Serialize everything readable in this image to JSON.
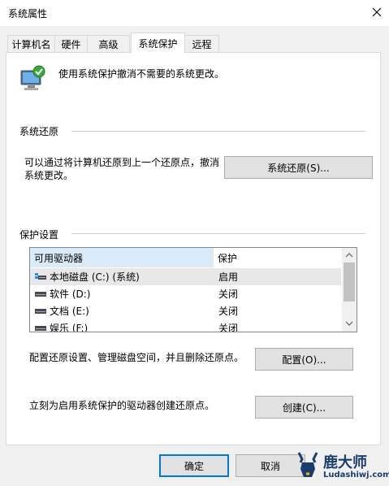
{
  "window": {
    "title": "系统属性"
  },
  "tabs": [
    {
      "label": "计算机名"
    },
    {
      "label": "硬件"
    },
    {
      "label": "高级"
    },
    {
      "label": "系统保护"
    },
    {
      "label": "远程"
    }
  ],
  "intro": {
    "text": "使用系统保护撤消不需要的系统更改。"
  },
  "restore": {
    "heading": "系统还原",
    "description_line1": "可以通过将计算机还原到上一个还原点，撤消",
    "description_line2": "系统更改。",
    "button": "系统还原(S)..."
  },
  "protection": {
    "heading": "保护设置",
    "columns": [
      "可用驱动器",
      "保护"
    ],
    "rows": [
      {
        "drive": "本地磁盘 (C:) (系统)",
        "status": "启用",
        "icon": "system-drive-icon"
      },
      {
        "drive": "软件 (D:)",
        "status": "关闭",
        "icon": "drive-icon"
      },
      {
        "drive": "文档 (E:)",
        "status": "关闭",
        "icon": "drive-icon"
      },
      {
        "drive": "娱乐 (F:)",
        "status": "关闭",
        "icon": "drive-icon"
      }
    ]
  },
  "configure": {
    "text": "配置还原设置、管理磁盘空间，并且删除还原点。",
    "button": "配置(O)..."
  },
  "create": {
    "text": "立刻为启用系统保护的驱动器创建还原点。",
    "button": "创建(C)..."
  },
  "footer": {
    "ok": "确定",
    "cancel": "取消"
  },
  "watermark": {
    "brand": "鹿大师",
    "url": "Ludashiwj.com"
  },
  "colors": {
    "accent": "#0078d7",
    "selection": "#e5f3ff"
  }
}
